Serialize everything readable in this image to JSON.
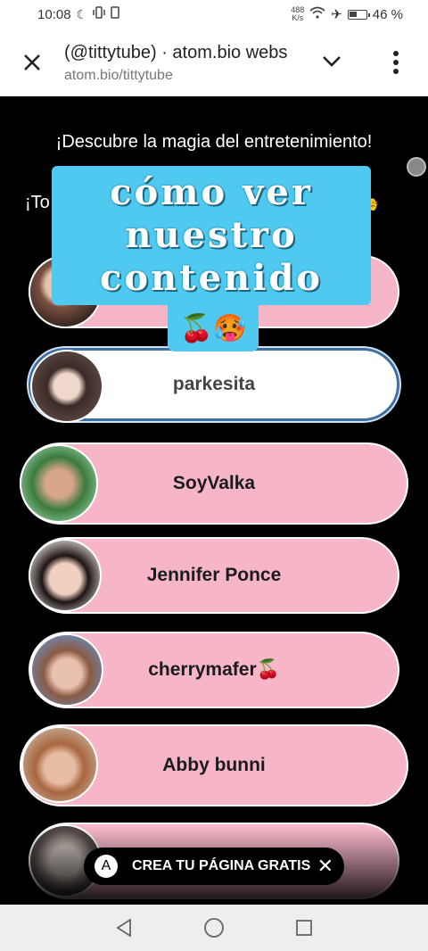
{
  "status_bar": {
    "time": "10:08",
    "net_speed_value": "488",
    "net_speed_unit": "K/s",
    "battery": "46 %",
    "icons": [
      "moon-icon",
      "vibrate-icon",
      "sim-icon",
      "wifi-icon",
      "airplane-icon",
      "battery-icon"
    ]
  },
  "browser": {
    "title": "(@tittytube) · atom.bio webs",
    "url": "atom.bio/tittytube",
    "icons": [
      "close-icon",
      "chevron-down-icon",
      "more-vert-icon"
    ]
  },
  "page": {
    "tagline": "¡Descubre la magia del entretenimiento!",
    "tagline2_start": "¡To",
    "tagline2_emoji": "🎭",
    "overlay_lines": [
      "cómo ver",
      "nuestro",
      "contenido"
    ],
    "overlay_emoji": "🍒🥵",
    "links": [
      {
        "label": ""
      },
      {
        "label": "parkesita"
      },
      {
        "label": "SoyValka"
      },
      {
        "label": "Jennifer Ponce"
      },
      {
        "label": "cherrymafer🍒"
      },
      {
        "label": "Abby bunni"
      },
      {
        "label": ""
      }
    ],
    "cta": {
      "logo": "A",
      "label": "CREA TU PÁGINA GRATIS",
      "close": "✕"
    }
  },
  "colors": {
    "card_pink": "#f7b6c8",
    "overlay_blue": "#4fc9ef",
    "page_bg": "#000000"
  }
}
